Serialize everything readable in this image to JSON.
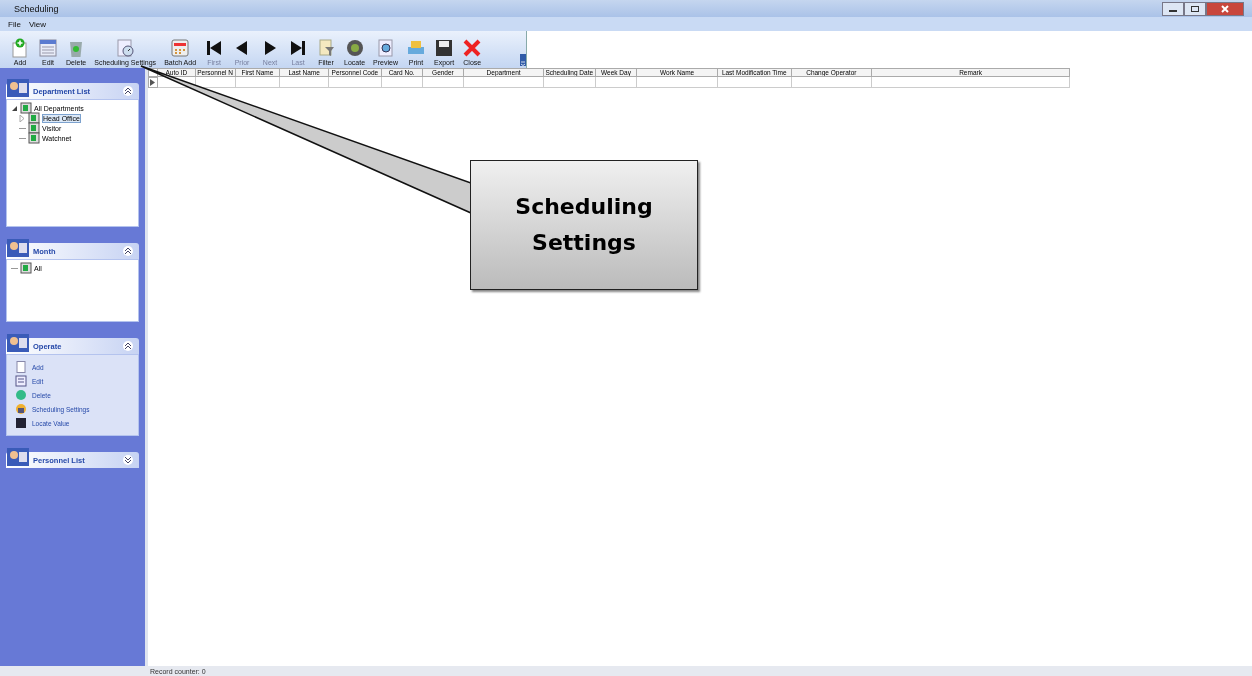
{
  "window": {
    "title": "Scheduling"
  },
  "menu": [
    "File",
    "View"
  ],
  "toolbar": [
    {
      "label": "Add",
      "disabled": false
    },
    {
      "label": "Edit",
      "disabled": false
    },
    {
      "label": "Delete",
      "disabled": false
    },
    {
      "label": "Scheduling Settings",
      "disabled": false
    },
    {
      "label": "Batch Add",
      "disabled": false
    },
    {
      "label": "First",
      "disabled": true
    },
    {
      "label": "Prior",
      "disabled": true
    },
    {
      "label": "Next",
      "disabled": true
    },
    {
      "label": "Last",
      "disabled": true
    },
    {
      "label": "Filter",
      "disabled": false
    },
    {
      "label": "Locate",
      "disabled": false
    },
    {
      "label": "Preview",
      "disabled": false
    },
    {
      "label": "Print",
      "disabled": false
    },
    {
      "label": "Export",
      "disabled": false
    },
    {
      "label": "Close",
      "disabled": false
    }
  ],
  "sidebar": {
    "panels": [
      {
        "title": "Department List",
        "expanded": true,
        "kind": "tree",
        "tree": [
          {
            "label": "All Departments",
            "expanded": true,
            "selected": false,
            "children": [
              {
                "label": "Head Office",
                "expanded": false,
                "selected": true
              },
              {
                "label": "Visitor",
                "selected": false
              },
              {
                "label": "Watchnet",
                "selected": false
              }
            ]
          }
        ]
      },
      {
        "title": "Month",
        "expanded": true,
        "kind": "tree",
        "tree": [
          {
            "label": "All",
            "selected": false
          }
        ]
      },
      {
        "title": "Operate",
        "expanded": true,
        "kind": "actions",
        "items": [
          "Add",
          "Edit",
          "Delete",
          "Scheduling Settings",
          "Locate Value"
        ]
      },
      {
        "title": "Personnel List",
        "expanded": false
      }
    ]
  },
  "table": {
    "columns": [
      "Auto ID",
      "Personnel N",
      "First Name",
      "Last Name",
      "Personnel Code",
      "Card No.",
      "Gender",
      "Department",
      "Scheduling Date",
      "Week Day",
      "Work Name",
      "Last Modification Time",
      "Change Operator",
      "Remark"
    ]
  },
  "status_bar": {
    "text": "Record counter: 0"
  },
  "callout": {
    "text": "Scheduling Settings"
  }
}
